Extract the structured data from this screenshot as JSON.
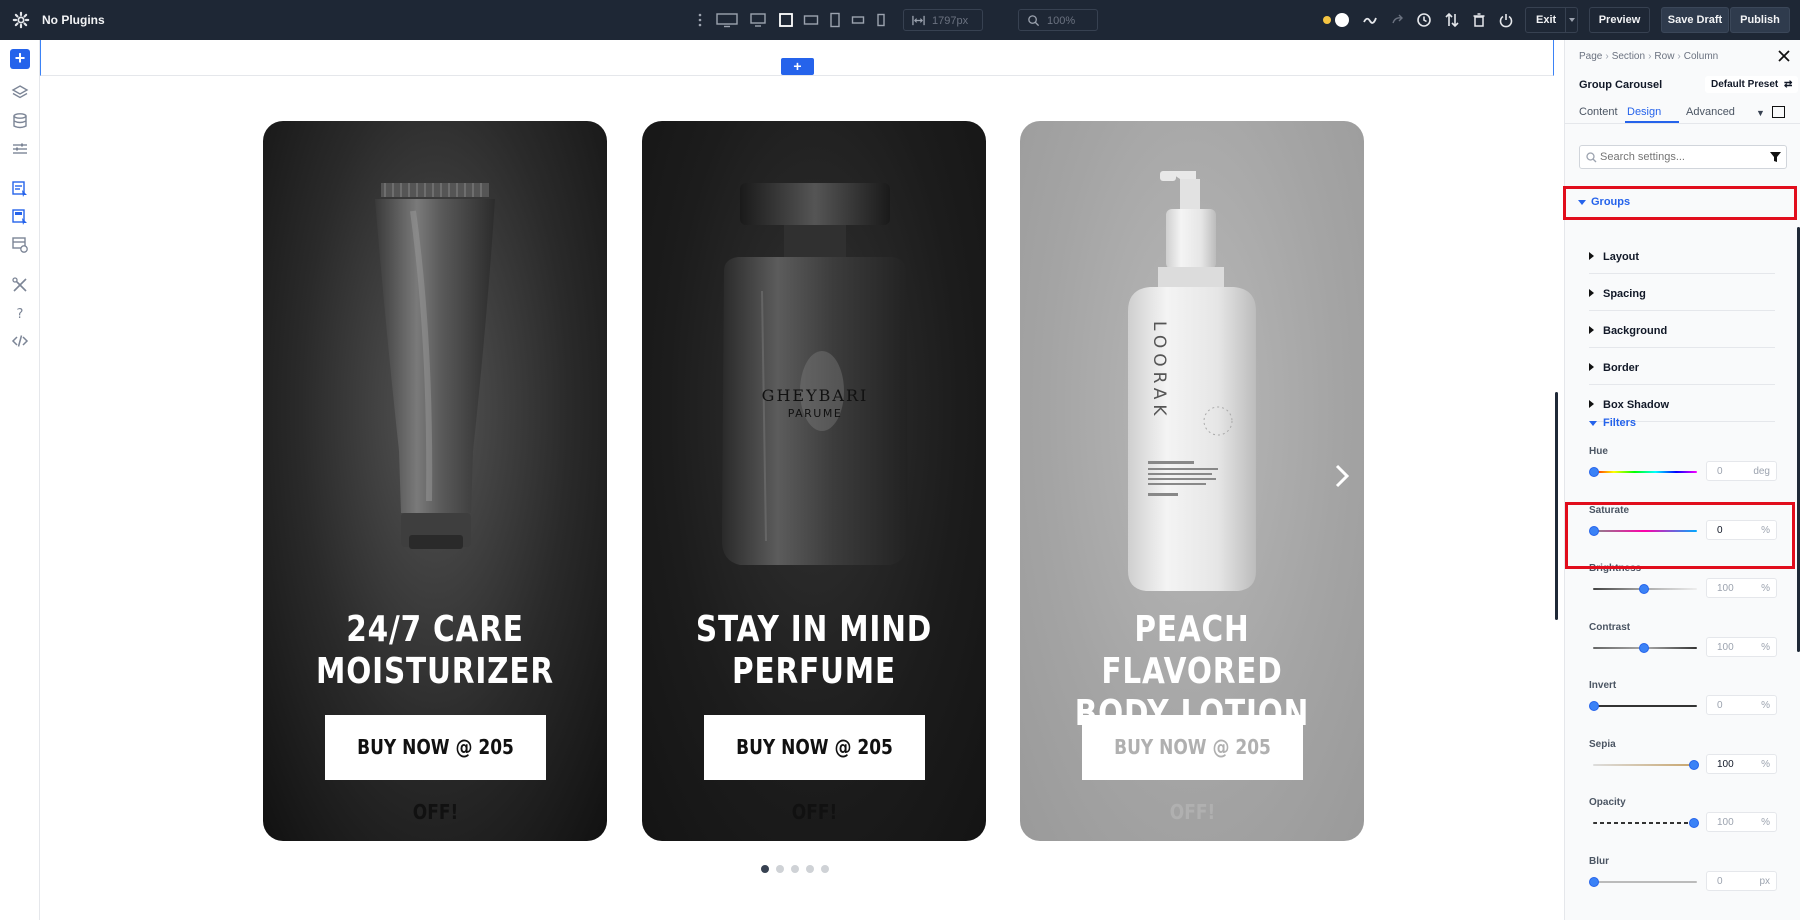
{
  "topbar": {
    "site_title": "No Plugins",
    "width_value": "1797px",
    "zoom_value": "100%",
    "exit_label": "Exit",
    "preview_label": "Preview",
    "save_draft_label": "Save Draft",
    "publish_label": "Publish"
  },
  "canvas": {
    "add_row_label": "+",
    "cards": [
      {
        "title_line1": "24/7 CARE",
        "title_line2": "MOISTURIZER",
        "button": "BUY NOW @ 205 OFF!"
      },
      {
        "title_line1": "STAY IN MIND",
        "title_line2": "PERFUME",
        "button": "BUY NOW @ 205 OFF!",
        "bottle_brand": "GHEYBARI",
        "bottle_sub": "PARUME"
      },
      {
        "title_line1": "PEACH FLAVORED",
        "title_line2": "BODY LOTION",
        "button": "BUY NOW @ 205 OFF!",
        "bottle_brand": "LOORAK"
      }
    ],
    "dots": 5,
    "active_dot": 0
  },
  "panel": {
    "breadcrumbs": [
      "Page",
      "Section",
      "Row",
      "Column"
    ],
    "module_name": "Group Carousel",
    "preset": "Default Preset",
    "tabs": [
      "Content",
      "Design",
      "Advanced"
    ],
    "active_tab": "Design",
    "search_placeholder": "Search settings...",
    "groups_label": "Groups",
    "subgroups": [
      "Layout",
      "Spacing",
      "Background",
      "Border",
      "Box Shadow"
    ],
    "filters_label": "Filters",
    "filters": [
      {
        "label": "Hue",
        "value": "0",
        "unit": "deg",
        "level": 0,
        "set": false
      },
      {
        "label": "Saturate",
        "value": "0",
        "unit": "%",
        "level": 0,
        "set": true
      },
      {
        "label": "Brightness",
        "value": "100",
        "unit": "%",
        "level": 0.5,
        "set": false
      },
      {
        "label": "Contrast",
        "value": "100",
        "unit": "%",
        "level": 0.5,
        "set": false
      },
      {
        "label": "Invert",
        "value": "0",
        "unit": "%",
        "level": 0,
        "set": false
      },
      {
        "label": "Sepia",
        "value": "100",
        "unit": "%",
        "level": 1,
        "set": true
      },
      {
        "label": "Opacity",
        "value": "100",
        "unit": "%",
        "level": 1,
        "set": false
      },
      {
        "label": "Blur",
        "value": "0",
        "unit": "px",
        "level": 0,
        "set": false
      }
    ]
  },
  "colors": {
    "accent": "#2563eb",
    "highlight": "#e10d1c",
    "topbar": "#1e2735"
  }
}
